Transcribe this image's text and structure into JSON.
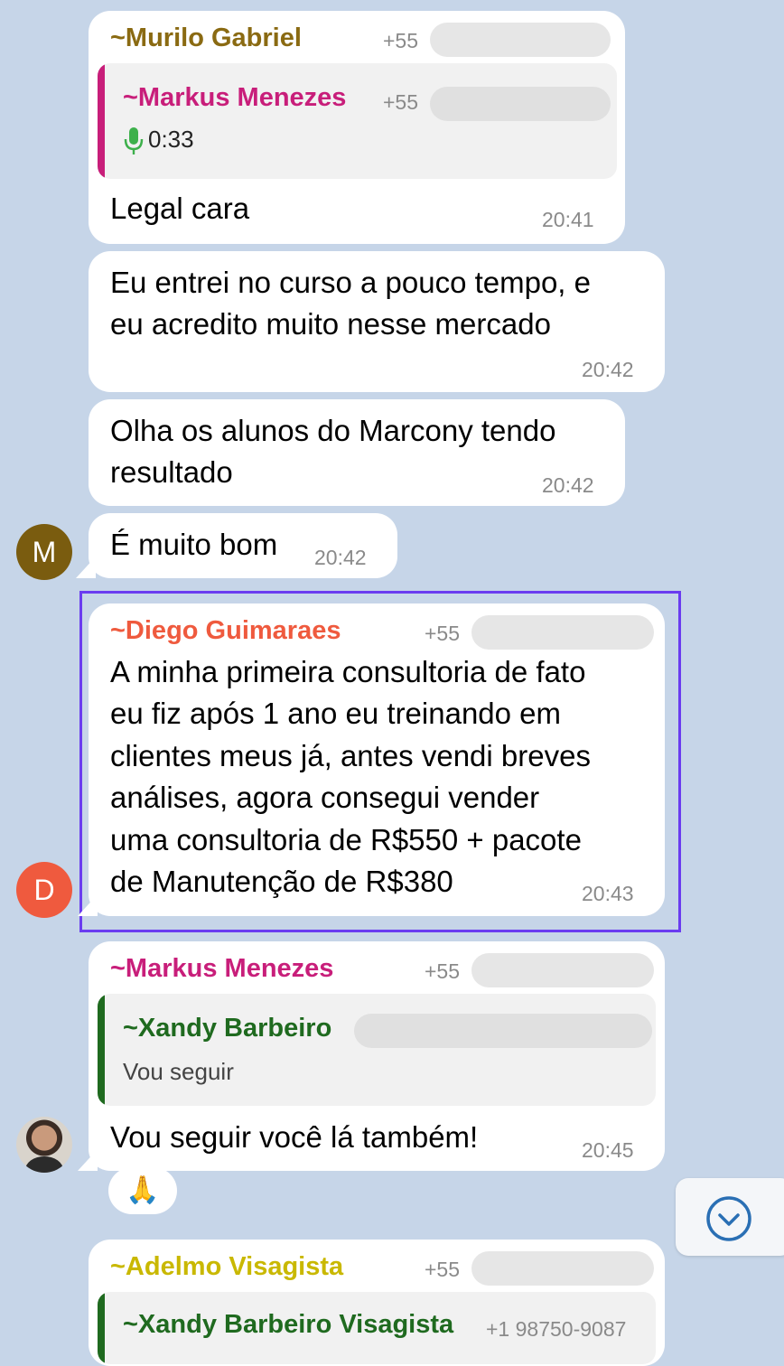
{
  "colors": {
    "background": "#c6d5e8",
    "murilo": "#8a6a12",
    "markus": "#c81e7a",
    "diego": "#ef5a3e",
    "xandy": "#1f6a1f",
    "adelmo": "#c9b800",
    "highlight": "#6a3cf0",
    "mic": "#3db04b",
    "avatar_m": "#7a5c0f",
    "avatar_d": "#ef5a3e",
    "scroll_icon": "#2a6fb4"
  },
  "messages": {
    "m1": {
      "sender": "~Murilo Gabriel",
      "phone": "+55",
      "quote_sender": "~Markus Menezes",
      "quote_phone": "+55",
      "quote_icon": "mic-icon",
      "quote_audio_duration": "0:33",
      "text": "Legal cara",
      "time": "20:41"
    },
    "m2": {
      "lines": [
        "Eu entrei no curso a pouco tempo, e",
        "eu acredito muito nesse mercado"
      ],
      "time": "20:42"
    },
    "m3": {
      "lines": [
        "Olha os alunos do Marcony tendo",
        "resultado"
      ],
      "time": "20:42"
    },
    "m4": {
      "avatar_letter": "M",
      "text": "É muito bom",
      "time": "20:42"
    },
    "m5": {
      "avatar_letter": "D",
      "sender": "~Diego Guimaraes",
      "phone": "+55",
      "lines": [
        "A minha primeira consultoria de fato",
        "eu fiz após 1 ano eu treinando em",
        "clientes meus já, antes vendi breves",
        "análises, agora consegui vender",
        "uma consultoria de R$550 + pacote",
        "de Manutenção de R$380"
      ],
      "time": "20:43"
    },
    "m6": {
      "sender": "~Markus Menezes",
      "phone": "+55",
      "quote_sender": "~Xandy Barbeiro",
      "quote_text": "Vou seguir",
      "text": "Vou seguir você lá também!",
      "time": "20:45",
      "reaction": "🙏"
    },
    "m7": {
      "sender": "~Adelmo Visagista",
      "phone": "+55",
      "quote_sender_partial": "~Xandy Barbeiro Visagista",
      "quote_phone_partial": "+1 98750-9087"
    }
  },
  "scroll_button_icon": "chevron-down-circle-icon"
}
